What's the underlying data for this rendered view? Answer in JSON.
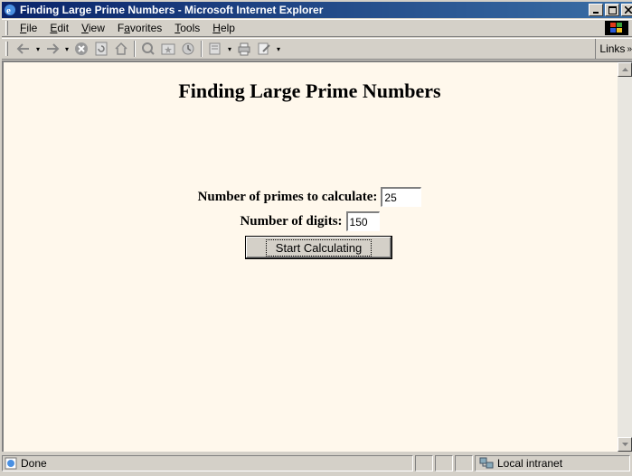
{
  "window": {
    "title": "Finding Large Prime Numbers - Microsoft Internet Explorer",
    "title_bar_color": "#0a246a"
  },
  "menu": {
    "items": [
      {
        "pre": "",
        "key": "F",
        "post": "ile"
      },
      {
        "pre": "",
        "key": "E",
        "post": "dit"
      },
      {
        "pre": "",
        "key": "V",
        "post": "iew"
      },
      {
        "pre": "F",
        "key": "a",
        "post": "vorites"
      },
      {
        "pre": "",
        "key": "T",
        "post": "ools"
      },
      {
        "pre": "",
        "key": "H",
        "post": "elp"
      }
    ]
  },
  "toolbar": {
    "links_label": "Links",
    "icons": [
      "back-icon",
      "forward-icon",
      "stop-icon",
      "refresh-icon",
      "home-icon",
      "search-icon",
      "favorites-icon",
      "history-icon",
      "mail-icon",
      "print-icon",
      "edit-icon"
    ]
  },
  "page": {
    "background": "#fff8ec",
    "heading": "Finding Large Prime Numbers",
    "primes_label": "Number of primes to calculate",
    "primes_colon": ":",
    "primes_value": "25",
    "digits_label": "Number of digits",
    "digits_colon": ":",
    "digits_value": "150",
    "button_label": "Start Calculating"
  },
  "status": {
    "text": "Done",
    "zone": "Local intranet"
  }
}
